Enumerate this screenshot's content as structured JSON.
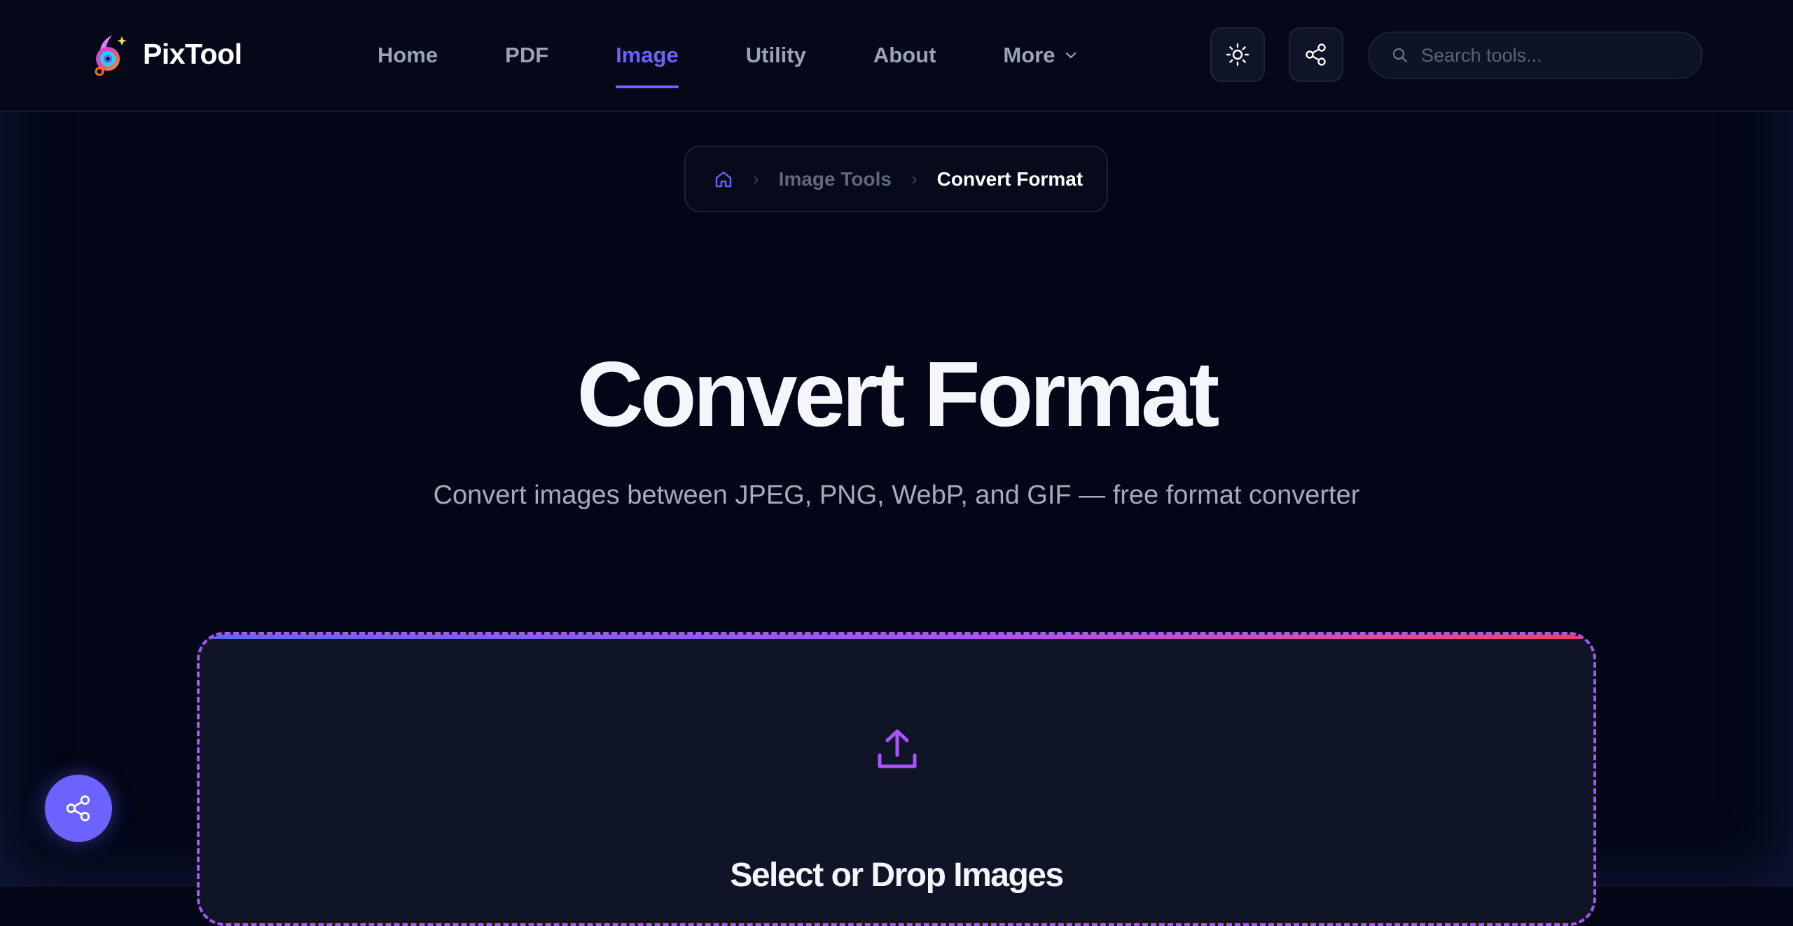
{
  "brand": {
    "name": "PixTool"
  },
  "nav": {
    "items": [
      {
        "label": "Home",
        "active": false
      },
      {
        "label": "PDF",
        "active": false
      },
      {
        "label": "Image",
        "active": true
      },
      {
        "label": "Utility",
        "active": false
      },
      {
        "label": "About",
        "active": false
      },
      {
        "label": "More",
        "active": false,
        "has_dropdown": true
      }
    ]
  },
  "header_actions": {
    "theme_icon": "sun-icon",
    "share_icon": "share-icon"
  },
  "search": {
    "placeholder": "Search tools...",
    "value": ""
  },
  "breadcrumb": {
    "home_icon": "home-icon",
    "items": [
      "Image Tools",
      "Convert Format"
    ]
  },
  "hero": {
    "title": "Convert Format",
    "subtitle": "Convert images between JPEG, PNG, WebP, and GIF — free format converter"
  },
  "dropzone": {
    "icon": "upload-icon",
    "title": "Select or Drop Images"
  },
  "colors": {
    "accent": "#6c63ff",
    "dropzone_border": "#a855f7",
    "background": "#030617"
  }
}
